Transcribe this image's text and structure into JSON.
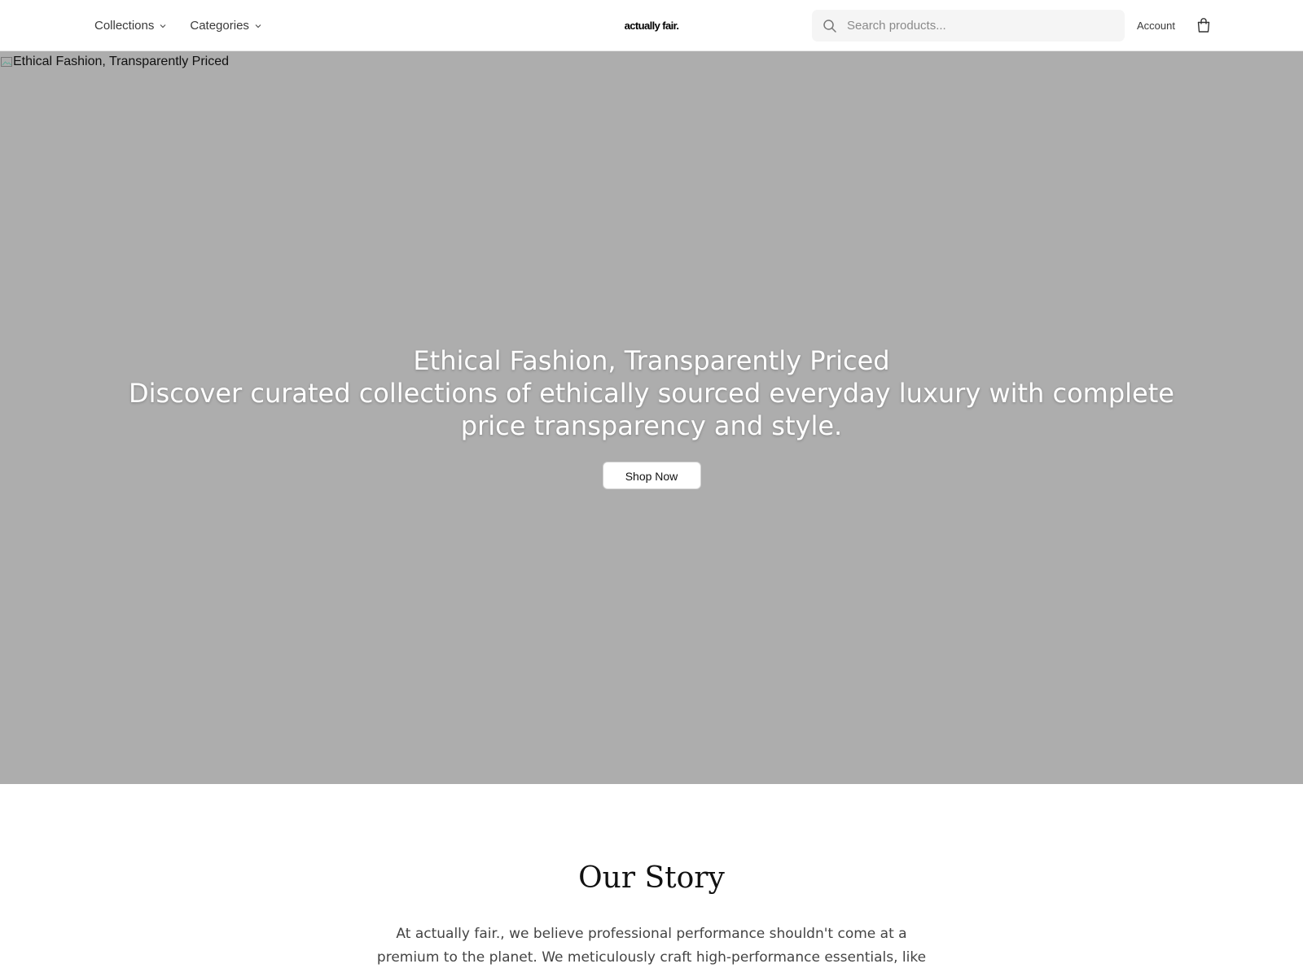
{
  "header": {
    "nav": [
      {
        "label": "Collections"
      },
      {
        "label": "Categories"
      }
    ],
    "logo": "actually fair.",
    "search": {
      "placeholder": "Search products..."
    },
    "account_label": "Account",
    "icons": {
      "search": "search-icon",
      "cart": "shopping-bag-icon",
      "dropdown": "chevron-down-icon"
    }
  },
  "hero": {
    "image_alt": "Ethical Fashion, Transparently Priced",
    "title": "Ethical Fashion, Transparently Priced",
    "subtitle": "Discover curated collections of ethically sourced everyday luxury with complete price transparency and style.",
    "cta_label": "Shop Now",
    "background_color": "#adadad"
  },
  "story": {
    "title": "Our Story",
    "text": "At actually fair., we believe professional performance shouldn't come at a premium to the planet. We meticulously craft high-performance essentials, like"
  }
}
